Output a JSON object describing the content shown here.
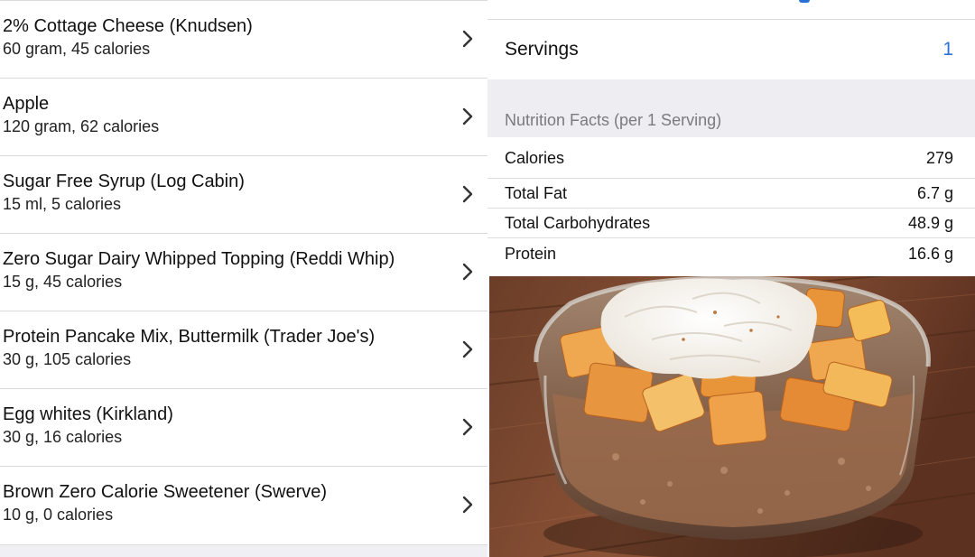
{
  "ingredients": [
    {
      "name": "2% Cottage Cheese (Knudsen)",
      "detail": "60 gram, 45 calories"
    },
    {
      "name": "Apple",
      "detail": "120 gram, 62 calories"
    },
    {
      "name": "Sugar Free Syrup (Log Cabin)",
      "detail": "15 ml, 5 calories"
    },
    {
      "name": "Zero Sugar Dairy Whipped Topping (Reddi Whip)",
      "detail": "15 g, 45 calories"
    },
    {
      "name": "Protein Pancake Mix, Buttermilk (Trader Joe's)",
      "detail": "30 g, 105 calories"
    },
    {
      "name": "Egg whites (Kirkland)",
      "detail": "30 g, 16 calories"
    },
    {
      "name": "Brown Zero Calorie Sweetener (Swerve)",
      "detail": "10 g, 0 calories"
    }
  ],
  "servings": {
    "label": "Servings",
    "value": "1"
  },
  "nutrition": {
    "header": "Nutrition Facts (per 1 Serving)",
    "rows": [
      {
        "label": "Calories",
        "value": "279"
      },
      {
        "label": "Total Fat",
        "value": "6.7 g"
      },
      {
        "label": "Total Carbohydrates",
        "value": "48.9 g"
      },
      {
        "label": "Protein",
        "value": "16.6 g"
      }
    ]
  },
  "colors": {
    "accent": "#2f73d6",
    "section_bg": "#eeeef2",
    "separator": "#d9d9d9"
  },
  "icons": {
    "row_disclosure": "chevron-right-icon"
  }
}
